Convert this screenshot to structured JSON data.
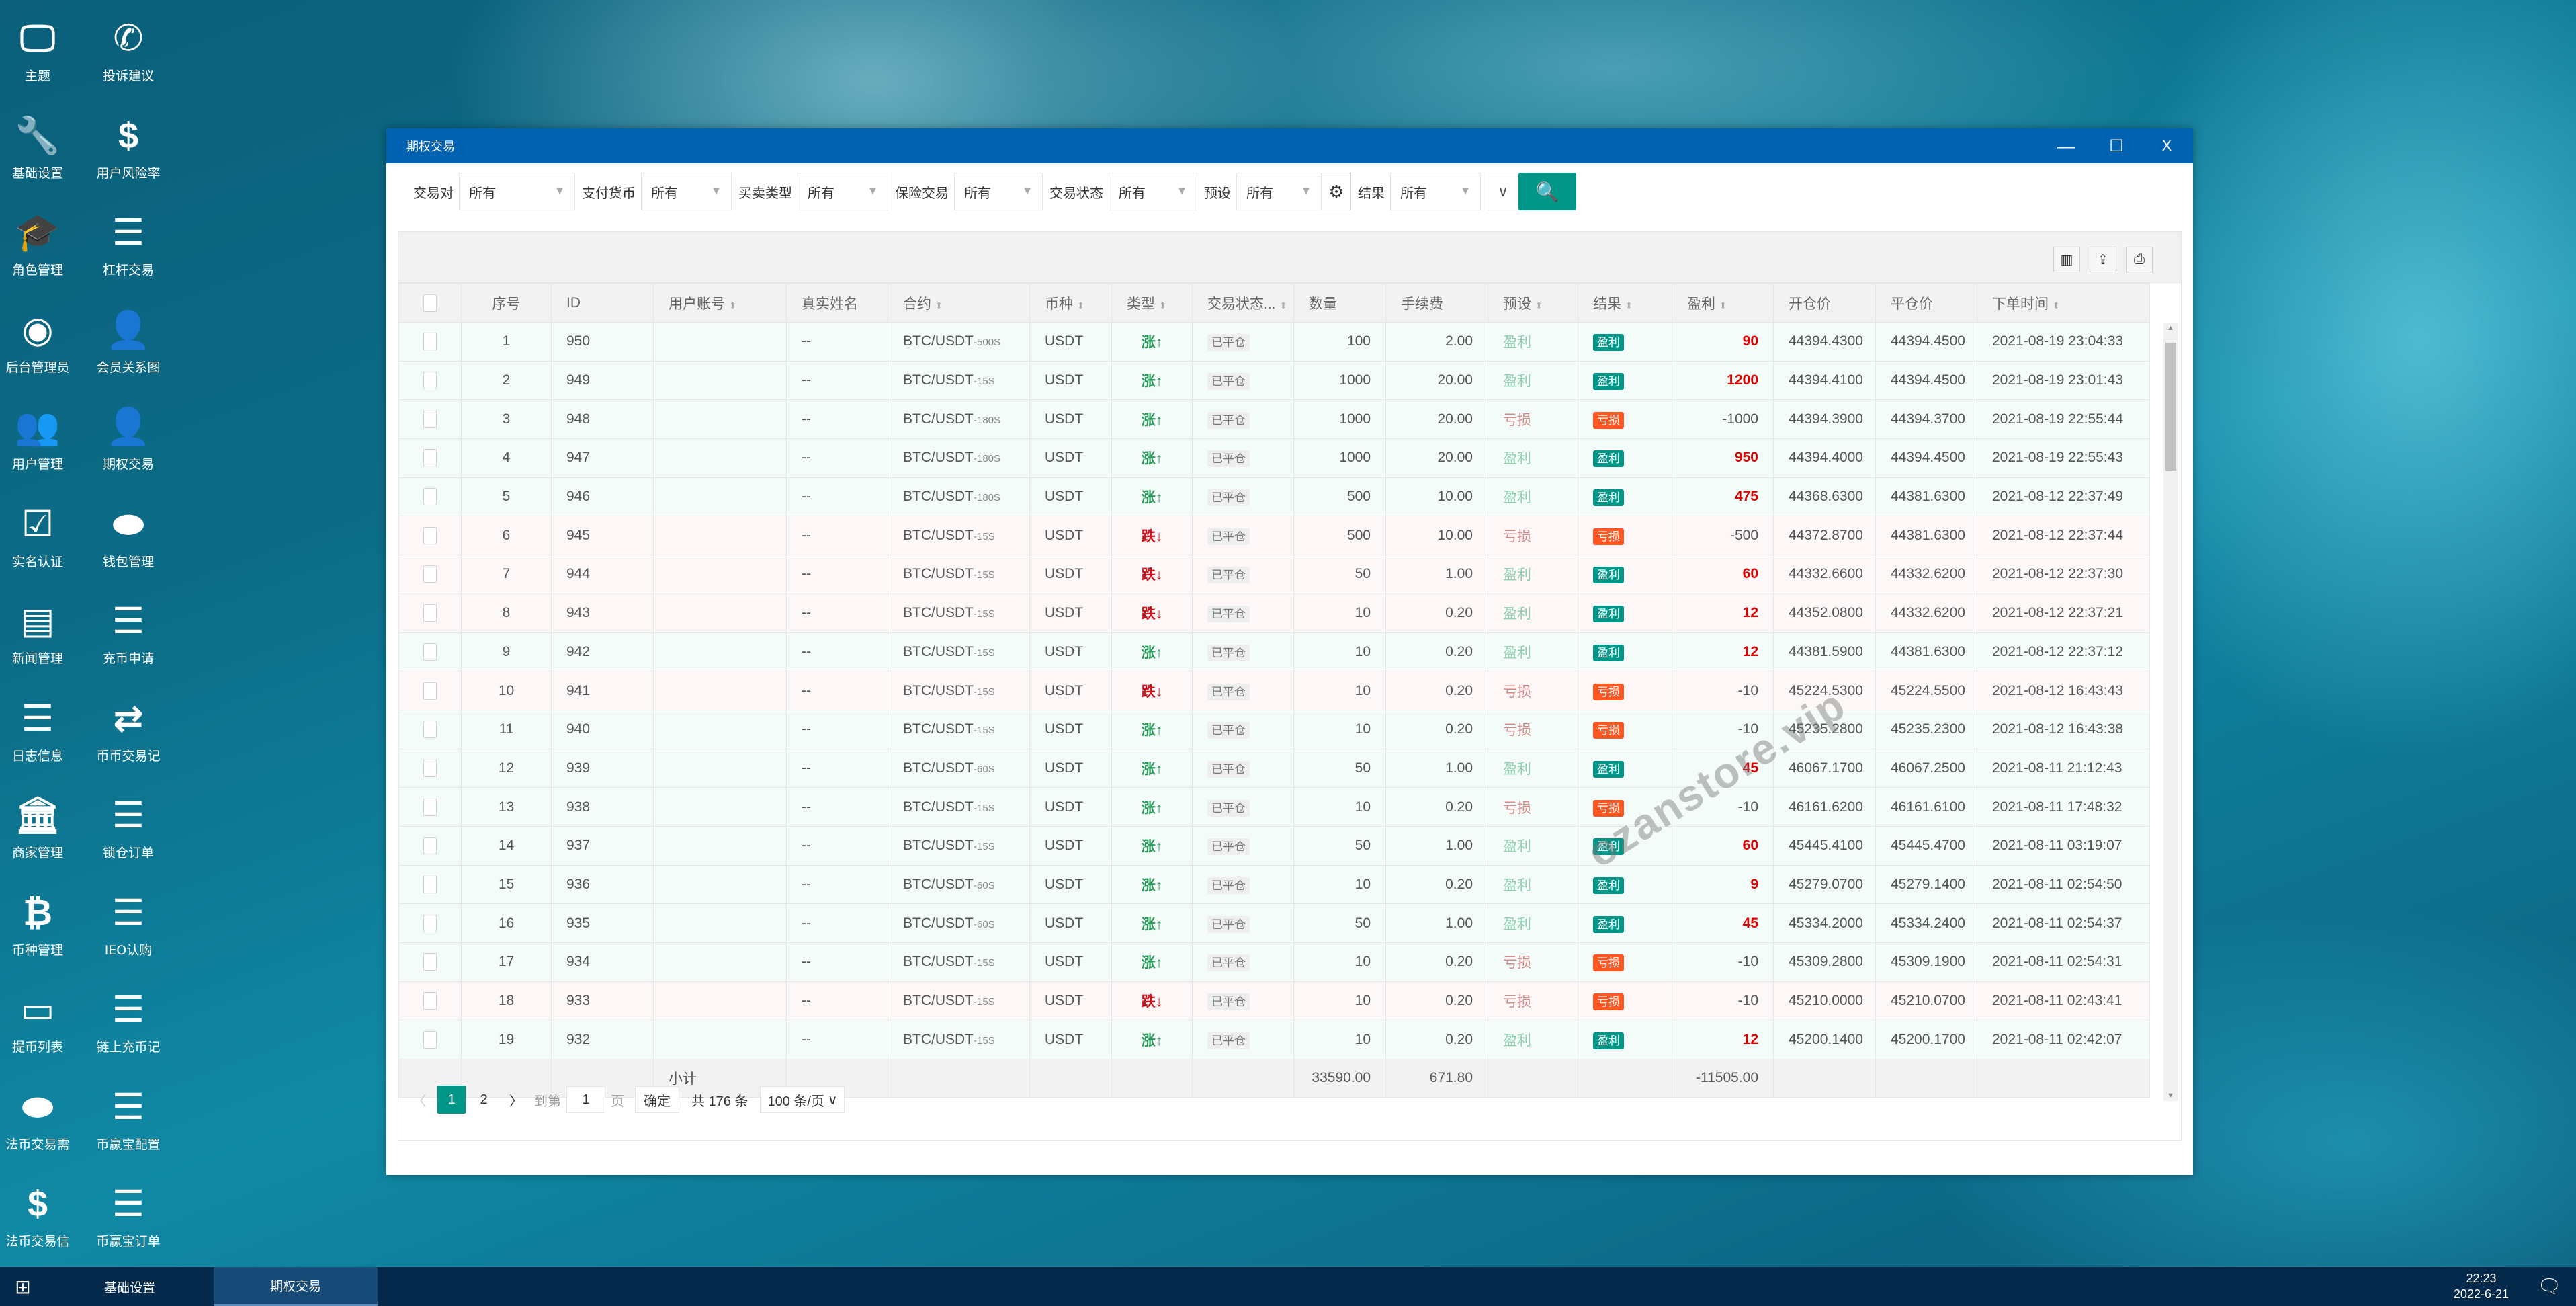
{
  "desktop": {
    "icons": [
      {
        "label": "主题",
        "icon": "monitor-icon"
      },
      {
        "label": "投诉建议",
        "icon": "phone-icon"
      },
      {
        "label": "基础设置",
        "icon": "wrench-icon"
      },
      {
        "label": "用户风险率",
        "icon": "dollar-icon"
      },
      {
        "label": "角色管理",
        "icon": "graduation-cap-icon"
      },
      {
        "label": "杠杆交易",
        "icon": "list-icon"
      },
      {
        "label": "后台管理员",
        "icon": "user-circle-icon"
      },
      {
        "label": "会员关系图",
        "icon": "user-plus-icon"
      },
      {
        "label": "用户管理",
        "icon": "users-icon"
      },
      {
        "label": "期权交易",
        "icon": "user-plus-icon"
      },
      {
        "label": "实名认证",
        "icon": "check-square-icon"
      },
      {
        "label": "钱包管理",
        "icon": "wallet-logo-icon"
      },
      {
        "label": "新闻管理",
        "icon": "newspaper-icon"
      },
      {
        "label": "充币申请",
        "icon": "list-icon"
      },
      {
        "label": "日志信息",
        "icon": "list-icon"
      },
      {
        "label": "币币交易记",
        "icon": "exchange-icon"
      },
      {
        "label": "商家管理",
        "icon": "bank-icon"
      },
      {
        "label": "锁仓订单",
        "icon": "list-icon"
      },
      {
        "label": "币种管理",
        "icon": "bitcoin-icon"
      },
      {
        "label": "IEO认购",
        "icon": "list-icon"
      },
      {
        "label": "提币列表",
        "icon": "credit-card-icon"
      },
      {
        "label": "链上充币记",
        "icon": "list-icon"
      },
      {
        "label": "法币交易需",
        "icon": "wallet-logo-icon"
      },
      {
        "label": "币赢宝配置",
        "icon": "list-icon"
      },
      {
        "label": "法币交易信",
        "icon": "dollar-icon"
      },
      {
        "label": "币赢宝订单",
        "icon": "list-icon"
      }
    ]
  },
  "window": {
    "title": "期权交易",
    "minimize": "—",
    "maximize": "☐",
    "close": "X"
  },
  "filters": [
    {
      "label": "交易对",
      "value": "所有"
    },
    {
      "label": "支付货币",
      "value": "所有"
    },
    {
      "label": "买卖类型",
      "value": "所有"
    },
    {
      "label": "保险交易",
      "value": "所有"
    },
    {
      "label": "交易状态",
      "value": "所有"
    },
    {
      "label": "预设",
      "value": "所有"
    },
    {
      "label": "结果",
      "value": "所有"
    }
  ],
  "filter_expand": "∨",
  "columns": [
    "序号",
    "ID",
    "用户账号",
    "真实姓名",
    "合约",
    "币种",
    "类型",
    "交易状态...",
    "数量",
    "手续费",
    "预设",
    "结果",
    "盈利",
    "开仓价",
    "平仓价",
    "下单时间"
  ],
  "sortable": [
    false,
    false,
    true,
    false,
    true,
    true,
    true,
    true,
    false,
    false,
    true,
    true,
    true,
    false,
    false,
    true
  ],
  "rows": [
    {
      "seq": "1",
      "id": "950",
      "account": "",
      "name": "--",
      "pair": "BTC/USDT",
      "period": "-500S",
      "coin": "USDT",
      "type": "涨↑",
      "status": "已平仓",
      "qty": "100",
      "fee": "2.00",
      "preset": "盈利",
      "result": "盈利",
      "profit": "90",
      "open": "44394.4300",
      "close": "44394.4500",
      "time": "2021-08-19 23:04:33"
    },
    {
      "seq": "2",
      "id": "949",
      "account": "",
      "name": "--",
      "pair": "BTC/USDT",
      "period": "-15S",
      "coin": "USDT",
      "type": "涨↑",
      "status": "已平仓",
      "qty": "1000",
      "fee": "20.00",
      "preset": "盈利",
      "result": "盈利",
      "profit": "1200",
      "open": "44394.4100",
      "close": "44394.4500",
      "time": "2021-08-19 23:01:43"
    },
    {
      "seq": "3",
      "id": "948",
      "account": "",
      "name": "--",
      "pair": "BTC/USDT",
      "period": "-180S",
      "coin": "USDT",
      "type": "涨↑",
      "status": "已平仓",
      "qty": "1000",
      "fee": "20.00",
      "preset": "亏损",
      "result": "亏损",
      "profit": "-1000",
      "open": "44394.3900",
      "close": "44394.3700",
      "time": "2021-08-19 22:55:44"
    },
    {
      "seq": "4",
      "id": "947",
      "account": "",
      "name": "--",
      "pair": "BTC/USDT",
      "period": "-180S",
      "coin": "USDT",
      "type": "涨↑",
      "status": "已平仓",
      "qty": "1000",
      "fee": "20.00",
      "preset": "盈利",
      "result": "盈利",
      "profit": "950",
      "open": "44394.4000",
      "close": "44394.4500",
      "time": "2021-08-19 22:55:43"
    },
    {
      "seq": "5",
      "id": "946",
      "account": "",
      "name": "--",
      "pair": "BTC/USDT",
      "period": "-180S",
      "coin": "USDT",
      "type": "涨↑",
      "status": "已平仓",
      "qty": "500",
      "fee": "10.00",
      "preset": "盈利",
      "result": "盈利",
      "profit": "475",
      "open": "44368.6300",
      "close": "44381.6300",
      "time": "2021-08-12 22:37:49"
    },
    {
      "seq": "6",
      "id": "945",
      "account": "",
      "name": "--",
      "pair": "BTC/USDT",
      "period": "-15S",
      "coin": "USDT",
      "type": "跌↓",
      "status": "已平仓",
      "qty": "500",
      "fee": "10.00",
      "preset": "亏损",
      "result": "亏损",
      "profit": "-500",
      "open": "44372.8700",
      "close": "44381.6300",
      "time": "2021-08-12 22:37:44"
    },
    {
      "seq": "7",
      "id": "944",
      "account": "",
      "name": "--",
      "pair": "BTC/USDT",
      "period": "-15S",
      "coin": "USDT",
      "type": "跌↓",
      "status": "已平仓",
      "qty": "50",
      "fee": "1.00",
      "preset": "盈利",
      "result": "盈利",
      "profit": "60",
      "open": "44332.6600",
      "close": "44332.6200",
      "time": "2021-08-12 22:37:30"
    },
    {
      "seq": "8",
      "id": "943",
      "account": "",
      "name": "--",
      "pair": "BTC/USDT",
      "period": "-15S",
      "coin": "USDT",
      "type": "跌↓",
      "status": "已平仓",
      "qty": "10",
      "fee": "0.20",
      "preset": "盈利",
      "result": "盈利",
      "profit": "12",
      "open": "44352.0800",
      "close": "44332.6200",
      "time": "2021-08-12 22:37:21"
    },
    {
      "seq": "9",
      "id": "942",
      "account": "",
      "name": "--",
      "pair": "BTC/USDT",
      "period": "-15S",
      "coin": "USDT",
      "type": "涨↑",
      "status": "已平仓",
      "qty": "10",
      "fee": "0.20",
      "preset": "盈利",
      "result": "盈利",
      "profit": "12",
      "open": "44381.5900",
      "close": "44381.6300",
      "time": "2021-08-12 22:37:12"
    },
    {
      "seq": "10",
      "id": "941",
      "account": "",
      "name": "--",
      "pair": "BTC/USDT",
      "period": "-15S",
      "coin": "USDT",
      "type": "跌↓",
      "status": "已平仓",
      "qty": "10",
      "fee": "0.20",
      "preset": "亏损",
      "result": "亏损",
      "profit": "-10",
      "open": "45224.5300",
      "close": "45224.5500",
      "time": "2021-08-12 16:43:43"
    },
    {
      "seq": "11",
      "id": "940",
      "account": "",
      "name": "--",
      "pair": "BTC/USDT",
      "period": "-15S",
      "coin": "USDT",
      "type": "涨↑",
      "status": "已平仓",
      "qty": "10",
      "fee": "0.20",
      "preset": "亏损",
      "result": "亏损",
      "profit": "-10",
      "open": "45235.2800",
      "close": "45235.2300",
      "time": "2021-08-12 16:43:38"
    },
    {
      "seq": "12",
      "id": "939",
      "account": "",
      "name": "--",
      "pair": "BTC/USDT",
      "period": "-60S",
      "coin": "USDT",
      "type": "涨↑",
      "status": "已平仓",
      "qty": "50",
      "fee": "1.00",
      "preset": "盈利",
      "result": "盈利",
      "profit": "45",
      "open": "46067.1700",
      "close": "46067.2500",
      "time": "2021-08-11 21:12:43"
    },
    {
      "seq": "13",
      "id": "938",
      "account": "",
      "name": "--",
      "pair": "BTC/USDT",
      "period": "-15S",
      "coin": "USDT",
      "type": "涨↑",
      "status": "已平仓",
      "qty": "10",
      "fee": "0.20",
      "preset": "亏损",
      "result": "亏损",
      "profit": "-10",
      "open": "46161.6200",
      "close": "46161.6100",
      "time": "2021-08-11 17:48:32"
    },
    {
      "seq": "14",
      "id": "937",
      "account": "",
      "name": "--",
      "pair": "BTC/USDT",
      "period": "-15S",
      "coin": "USDT",
      "type": "涨↑",
      "status": "已平仓",
      "qty": "50",
      "fee": "1.00",
      "preset": "盈利",
      "result": "盈利",
      "profit": "60",
      "open": "45445.4100",
      "close": "45445.4700",
      "time": "2021-08-11 03:19:07"
    },
    {
      "seq": "15",
      "id": "936",
      "account": "",
      "name": "--",
      "pair": "BTC/USDT",
      "period": "-60S",
      "coin": "USDT",
      "type": "涨↑",
      "status": "已平仓",
      "qty": "10",
      "fee": "0.20",
      "preset": "盈利",
      "result": "盈利",
      "profit": "9",
      "open": "45279.0700",
      "close": "45279.1400",
      "time": "2021-08-11 02:54:50"
    },
    {
      "seq": "16",
      "id": "935",
      "account": "",
      "name": "--",
      "pair": "BTC/USDT",
      "period": "-60S",
      "coin": "USDT",
      "type": "涨↑",
      "status": "已平仓",
      "qty": "50",
      "fee": "1.00",
      "preset": "盈利",
      "result": "盈利",
      "profit": "45",
      "open": "45334.2000",
      "close": "45334.2400",
      "time": "2021-08-11 02:54:37"
    },
    {
      "seq": "17",
      "id": "934",
      "account": "",
      "name": "--",
      "pair": "BTC/USDT",
      "period": "-15S",
      "coin": "USDT",
      "type": "涨↑",
      "status": "已平仓",
      "qty": "10",
      "fee": "0.20",
      "preset": "亏损",
      "result": "亏损",
      "profit": "-10",
      "open": "45309.2800",
      "close": "45309.1900",
      "time": "2021-08-11 02:54:31"
    },
    {
      "seq": "18",
      "id": "933",
      "account": "",
      "name": "--",
      "pair": "BTC/USDT",
      "period": "-15S",
      "coin": "USDT",
      "type": "跌↓",
      "status": "已平仓",
      "qty": "10",
      "fee": "0.20",
      "preset": "亏损",
      "result": "亏损",
      "profit": "-10",
      "open": "45210.0000",
      "close": "45210.0700",
      "time": "2021-08-11 02:43:41"
    },
    {
      "seq": "19",
      "id": "932",
      "account": "",
      "name": "--",
      "pair": "BTC/USDT",
      "period": "-15S",
      "coin": "USDT",
      "type": "涨↑",
      "status": "已平仓",
      "qty": "10",
      "fee": "0.20",
      "preset": "盈利",
      "result": "盈利",
      "profit": "12",
      "open": "45200.1400",
      "close": "45200.1700",
      "time": "2021-08-11 02:42:07"
    }
  ],
  "subtotal": {
    "label": "小计",
    "qty": "33590.00",
    "fee": "671.80",
    "profit": "-11505.00"
  },
  "pagination": {
    "prev": "〈",
    "pages": [
      "1",
      "2"
    ],
    "current": "1",
    "next": "〉",
    "goto_label": "到第",
    "goto_value": "1",
    "page_unit": "页",
    "confirm": "确定",
    "total": "共 176 条",
    "page_size": "100 条/页"
  },
  "watermark": "ozanstore.vip",
  "taskbar": {
    "items": [
      "基础设置",
      "期权交易"
    ],
    "active": "期权交易",
    "time": "22:23",
    "date": "2022-6-21"
  },
  "colors": {
    "titlebar": "#0062b1",
    "accent": "#009688",
    "loss_badge": "#ff5722",
    "profit_text": "#dd0000",
    "up": "#2a9a5a",
    "down": "#d0101a"
  }
}
